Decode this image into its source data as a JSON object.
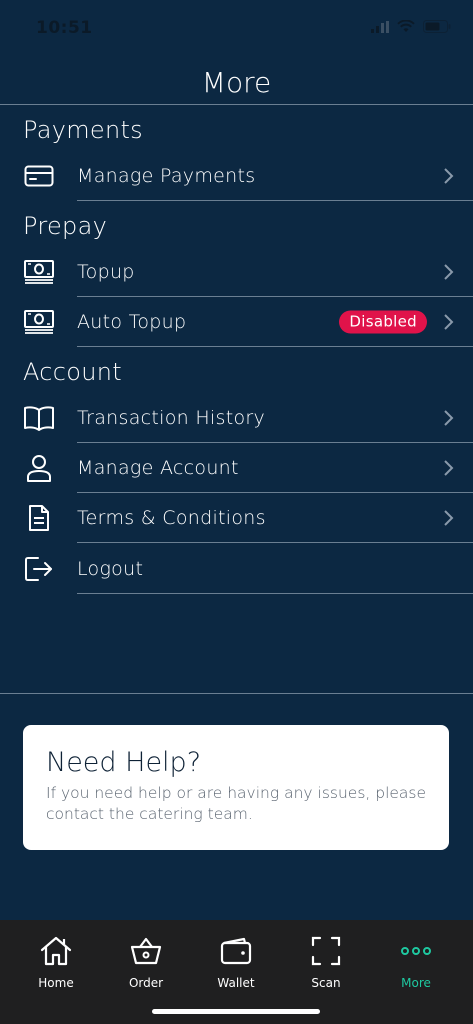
{
  "status": {
    "time": "10:51"
  },
  "header": {
    "title": "More"
  },
  "sections": {
    "payments": {
      "title": "Payments",
      "items": [
        {
          "label": "Manage Payments",
          "icon": "credit-card-icon"
        }
      ]
    },
    "prepay": {
      "title": "Prepay",
      "items": [
        {
          "label": "Topup",
          "icon": "cash-icon"
        },
        {
          "label": "Auto Topup",
          "icon": "cash-icon",
          "badge": "Disabled"
        }
      ]
    },
    "account": {
      "title": "Account",
      "items": [
        {
          "label": "Transaction History",
          "icon": "book-icon"
        },
        {
          "label": "Manage Account",
          "icon": "user-icon"
        },
        {
          "label": "Terms & Conditions",
          "icon": "document-icon"
        },
        {
          "label": "Logout",
          "icon": "logout-icon"
        }
      ]
    }
  },
  "help": {
    "title": "Need Help?",
    "text": "If you need help or are having any issues, please contact the catering team."
  },
  "tabs": [
    {
      "label": "Home",
      "icon": "home-icon"
    },
    {
      "label": "Order",
      "icon": "basket-icon"
    },
    {
      "label": "Wallet",
      "icon": "wallet-icon"
    },
    {
      "label": "Scan",
      "icon": "scan-icon"
    },
    {
      "label": "More",
      "icon": "more-dots-icon",
      "active": true
    }
  ],
  "colors": {
    "background": "#0c2842",
    "badge": "#e0134a",
    "accent": "#1ec8a0",
    "tab_bar": "#1f1f20"
  }
}
